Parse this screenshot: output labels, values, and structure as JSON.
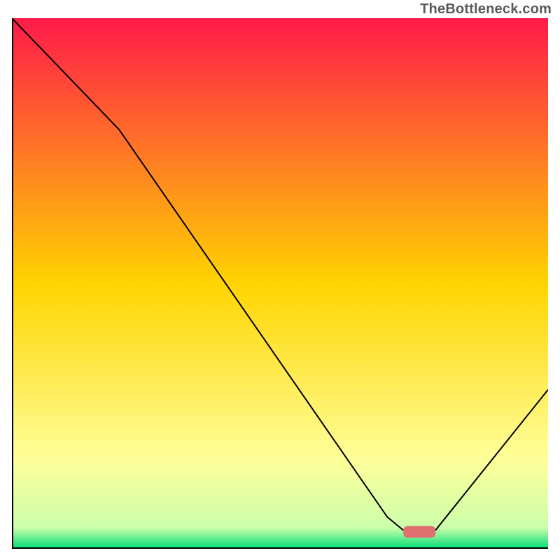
{
  "watermark": "TheBottleneck.com",
  "chart_data": {
    "type": "line",
    "title": "",
    "xlabel": "",
    "ylabel": "",
    "xlim": [
      0,
      100
    ],
    "ylim": [
      0,
      100
    ],
    "background_gradient": {
      "top": "#ff1a4a",
      "middle": "#ffd400",
      "lower": "#ffff99",
      "bottom": "#00dd77"
    },
    "series": [
      {
        "name": "bottleneck-curve",
        "color": "#000000",
        "points": [
          {
            "x": 0,
            "y": 100
          },
          {
            "x": 20,
            "y": 79
          },
          {
            "x": 70,
            "y": 6
          },
          {
            "x": 73,
            "y": 3.5
          },
          {
            "x": 79,
            "y": 3.5
          },
          {
            "x": 100,
            "y": 30
          }
        ]
      }
    ],
    "marker": {
      "name": "target-marker",
      "color": "#e07070",
      "x_start": 73,
      "x_end": 79,
      "y": 3.2,
      "thickness": 2.2
    }
  }
}
